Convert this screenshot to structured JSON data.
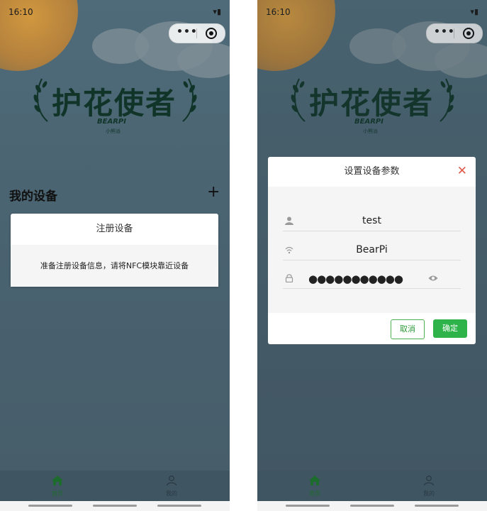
{
  "left_screen": {
    "status_time": "16:10",
    "logo_title": "护花使者",
    "logo_brand": "BEARPI",
    "logo_sub": "小熊派",
    "section_title": "我的设备",
    "add_symbol": "+",
    "register_card": {
      "title": "注册设备",
      "message": "准备注册设备信息，请将NFC模块靠近设备"
    },
    "tabs": [
      {
        "label": "首页",
        "icon": "home-icon",
        "active": true
      },
      {
        "label": "我的",
        "icon": "user-icon",
        "active": false
      }
    ]
  },
  "right_screen": {
    "status_time": "16:10",
    "logo_title": "护花使者",
    "logo_brand": "BEARPI",
    "logo_sub": "小熊派",
    "dialog": {
      "title": "设置设备参数",
      "close_symbol": "✕",
      "fields": [
        {
          "icon": "user-icon",
          "value": "test"
        },
        {
          "icon": "wifi-icon",
          "value": "BearPi"
        },
        {
          "icon": "lock-icon",
          "value": "●●●●●●●●●●●"
        }
      ],
      "cancel_label": "取消",
      "confirm_label": "确定"
    },
    "tabs": [
      {
        "label": "首页",
        "icon": "home-icon",
        "active": true
      },
      {
        "label": "我的",
        "icon": "user-icon",
        "active": false
      }
    ]
  },
  "colors": {
    "primary_green": "#2db34a",
    "close_red": "#e05a4a",
    "active_tab": "#1e6b2e",
    "inactive_tab": "#2a3a44"
  }
}
